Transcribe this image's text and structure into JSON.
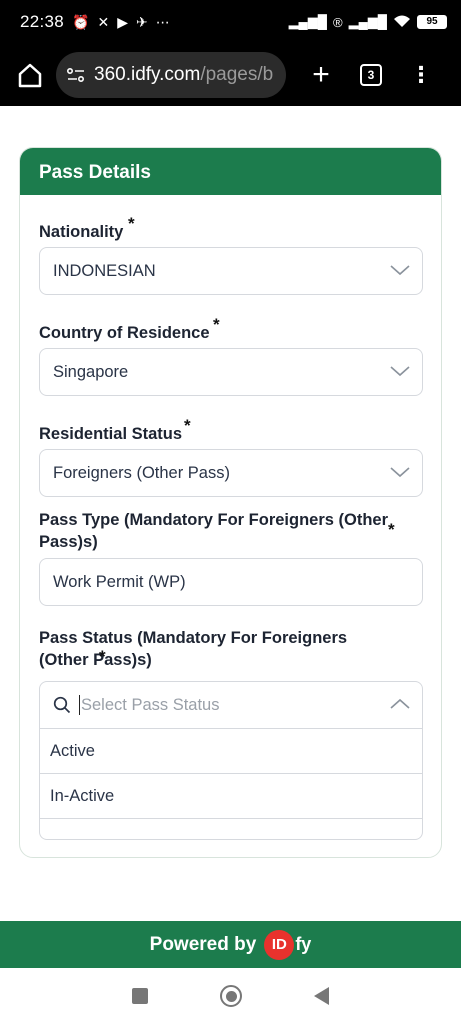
{
  "status_bar": {
    "time": "22:38",
    "battery": "95"
  },
  "browser": {
    "url_host": "360.idfy.com",
    "url_path": "/pages/b",
    "tab_count": "3"
  },
  "card": {
    "title": "Pass Details",
    "fields": [
      {
        "label": "Nationality",
        "value": "INDONESIAN"
      },
      {
        "label": "Country of Residence",
        "value": "Singapore"
      },
      {
        "label": "Residential Status",
        "value": "Foreigners (Other Pass)"
      },
      {
        "label": "Pass Type (Mandatory For Foreigners (Other Pass)s)",
        "value": "Work Permit (WP)"
      },
      {
        "label": "Pass Status (Mandatory For Foreigners (Other Pass)s)",
        "placeholder": "Select Pass Status",
        "options": [
          "Active",
          "In-Active"
        ]
      }
    ],
    "required_mark": "*"
  },
  "footer": {
    "powered_by": "Powered by",
    "logo_id": "ID",
    "logo_fy": "fy"
  },
  "colors": {
    "brand_green": "#1c7c4d",
    "logo_red": "#e8322d"
  }
}
